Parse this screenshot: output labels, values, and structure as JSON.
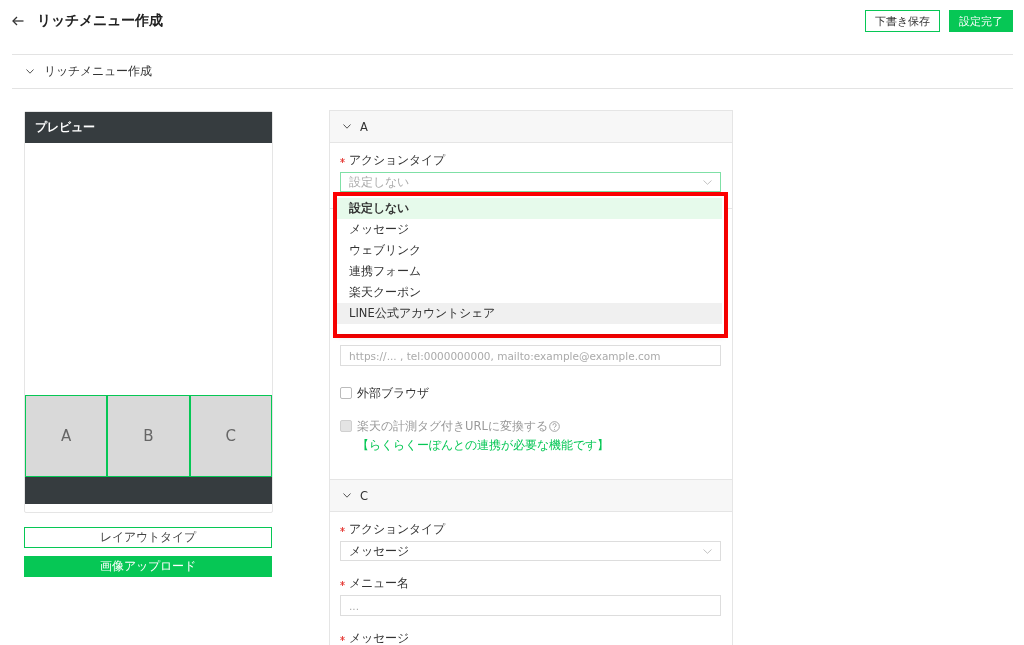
{
  "header": {
    "title": "リッチメニュー作成",
    "buttons": [
      {
        "label": "下書き保存",
        "kind": "outline"
      },
      {
        "label": "設定完了",
        "kind": "primary"
      }
    ]
  },
  "collapsible": {
    "title": "リッチメニュー作成",
    "expanded": true
  },
  "preview": {
    "title": "プレビュー",
    "areas": [
      {
        "label": "A"
      },
      {
        "label": "B"
      },
      {
        "label": "C"
      }
    ],
    "buttons": [
      {
        "label": "レイアウトタイプ",
        "kind": "outline"
      },
      {
        "label": "画像アップロード",
        "kind": "primary"
      }
    ]
  },
  "form": {
    "sections": [
      {
        "title": "A",
        "expanded": true,
        "fields": [
          {
            "kind": "select",
            "label": "アクションタイプ",
            "required": true,
            "placeholder": "設定しない",
            "focused": true,
            "dropdown": {
              "highlighted": true,
              "options": [
                {
                  "label": "設定しない",
                  "selected": true,
                  "hovered": false
                },
                {
                  "label": "メッセージ",
                  "selected": false,
                  "hovered": false
                },
                {
                  "label": "ウェブリンク",
                  "selected": false,
                  "hovered": false
                },
                {
                  "label": "連携フォーム",
                  "selected": false,
                  "hovered": false
                },
                {
                  "label": "楽天クーポン",
                  "selected": false,
                  "hovered": false
                },
                {
                  "label": "LINE公式アカウントシェア",
                  "selected": false,
                  "hovered": true
                }
              ]
            }
          }
        ]
      },
      {
        "fields": [
          {
            "kind": "input",
            "placeholder": "https://... , tel:0000000000, mailto:example@example.com"
          },
          {
            "kind": "checkbox",
            "label": "外部ブラウザ",
            "checked": false,
            "disabled": false
          },
          {
            "kind": "checkbox",
            "label": "楽天の計測タグ付きURLに変換する",
            "checked": false,
            "disabled": true,
            "help": true,
            "note": "【らくらくーぽんとの連携が必要な機能です】"
          }
        ]
      },
      {
        "title": "C",
        "expanded": true,
        "fields": [
          {
            "kind": "select",
            "label": "アクションタイプ",
            "required": true,
            "value": "メッセージ",
            "focused": false
          },
          {
            "kind": "input",
            "label": "メニュー名",
            "required": true,
            "placeholder": "..."
          },
          {
            "kind": "label",
            "label": "メッセージ",
            "required": true
          }
        ]
      }
    ]
  }
}
